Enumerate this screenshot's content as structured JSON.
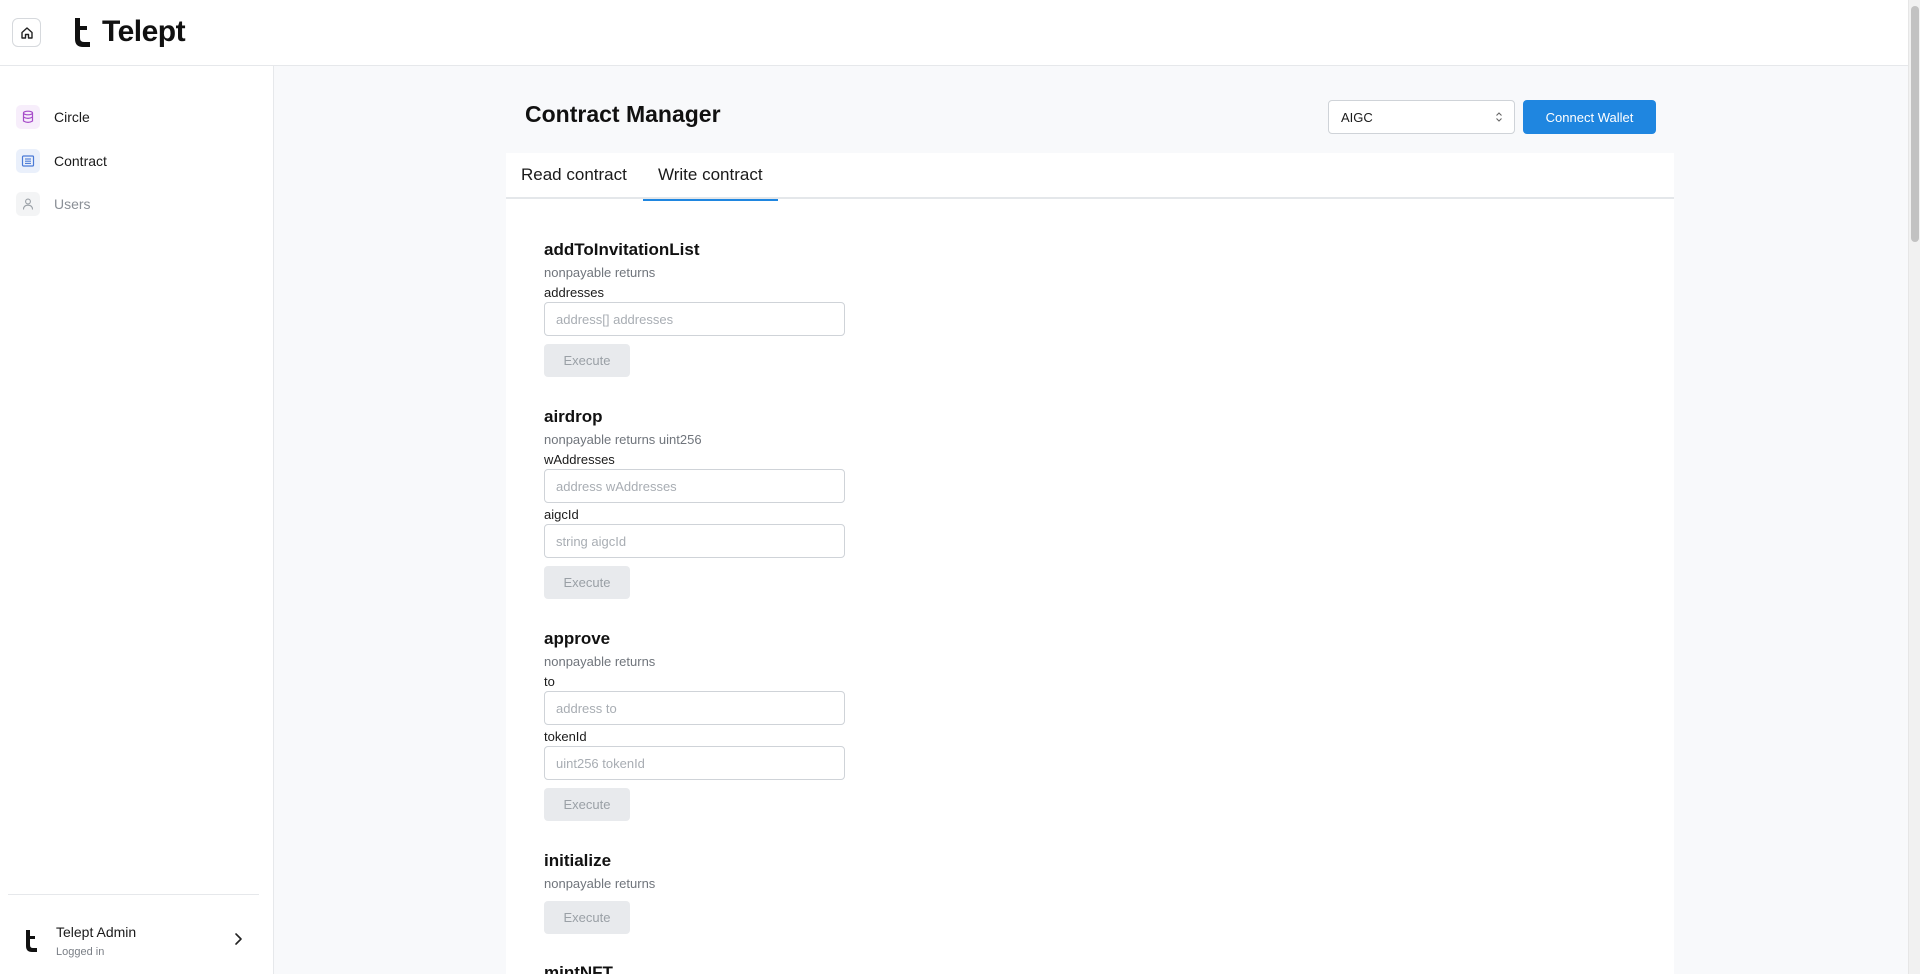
{
  "brand": {
    "name": "Telept"
  },
  "sidebar": {
    "items": [
      {
        "label": "Circle",
        "icon": "database-icon",
        "color": "#a64cc9"
      },
      {
        "label": "Contract",
        "icon": "list-icon",
        "color": "#4a7ad6"
      },
      {
        "label": "Users",
        "icon": "user-icon",
        "color": "#9aa0a6"
      }
    ],
    "user": {
      "name": "Telept Admin",
      "status": "Logged in"
    }
  },
  "main": {
    "title": "Contract Manager",
    "contract_select": "AIGC",
    "connect_label": "Connect Wallet",
    "tabs": [
      {
        "label": "Read contract",
        "active": false
      },
      {
        "label": "Write contract",
        "active": true
      }
    ],
    "functions": {
      "f0": {
        "name": "addToInvitationList",
        "sub": "nonpayable returns",
        "params": [
          {
            "label": "addresses",
            "placeholder": "address[] addresses"
          }
        ]
      },
      "f1": {
        "name": "airdrop",
        "sub": "nonpayable returns uint256",
        "params": [
          {
            "label": "wAddresses",
            "placeholder": "address wAddresses"
          },
          {
            "label": "aigcId",
            "placeholder": "string aigcId"
          }
        ]
      },
      "f2": {
        "name": "approve",
        "sub": "nonpayable returns",
        "params": [
          {
            "label": "to",
            "placeholder": "address to"
          },
          {
            "label": "tokenId",
            "placeholder": "uint256 tokenId"
          }
        ]
      },
      "f3": {
        "name": "initialize",
        "sub": "nonpayable returns"
      },
      "f4": {
        "name": "mintNFT"
      }
    },
    "execute_label": "Execute"
  },
  "colors": {
    "accent": "#1f86e0"
  }
}
